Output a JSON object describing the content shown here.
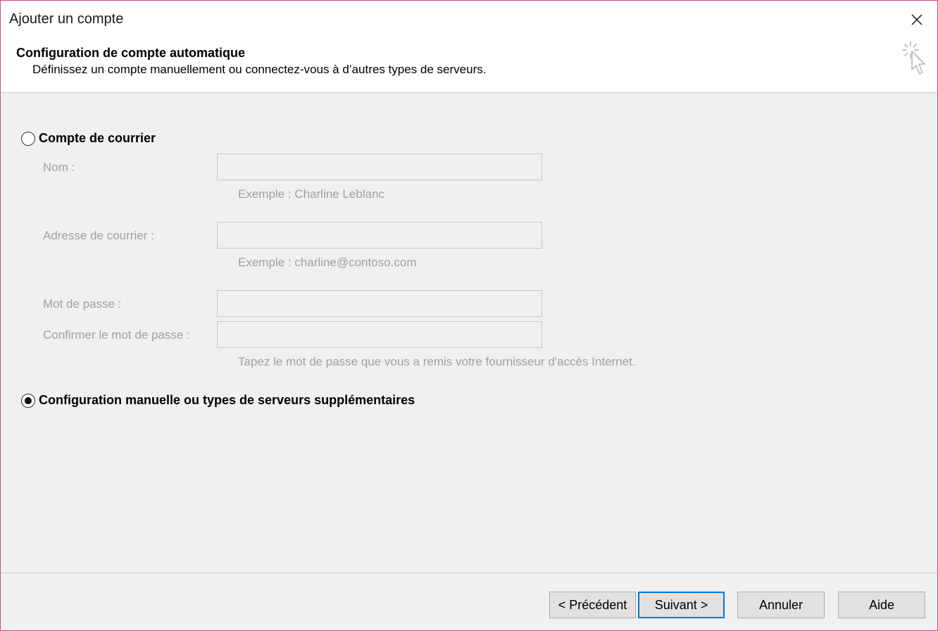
{
  "window": {
    "title": "Ajouter un compte",
    "close_icon": "close-icon",
    "border_color": "#d6428f"
  },
  "header": {
    "title": "Configuration de compte automatique",
    "subtitle": "Définissez un compte manuellement ou connectez-vous à d’autres types de serveurs.",
    "icon": "wizard-cursor-icon"
  },
  "options": {
    "email_account": {
      "label": "Compte de courrier",
      "selected": false
    },
    "manual_setup": {
      "label": "Configuration manuelle ou types de serveurs supplémentaires",
      "selected": true
    }
  },
  "form": {
    "name": {
      "label": "Nom :",
      "value": "",
      "hint": "Exemple : Charline Leblanc"
    },
    "email": {
      "label": "Adresse de courrier :",
      "value": "",
      "hint": "Exemple : charline@contoso.com"
    },
    "password": {
      "label": "Mot de passe :",
      "value": ""
    },
    "confirm_password": {
      "label": "Confirmer le mot de passe :",
      "value": ""
    },
    "password_hint": "Tapez le mot de passe que vous a remis votre fournisseur d'accès Internet."
  },
  "buttons": {
    "previous": "< Précédent",
    "next": "Suivant >",
    "cancel": "Annuler",
    "help": "Aide"
  },
  "colors": {
    "accent": "#0078d7",
    "disabled_text": "#a0a0a0",
    "dialog_bg": "#f0f0f0"
  }
}
